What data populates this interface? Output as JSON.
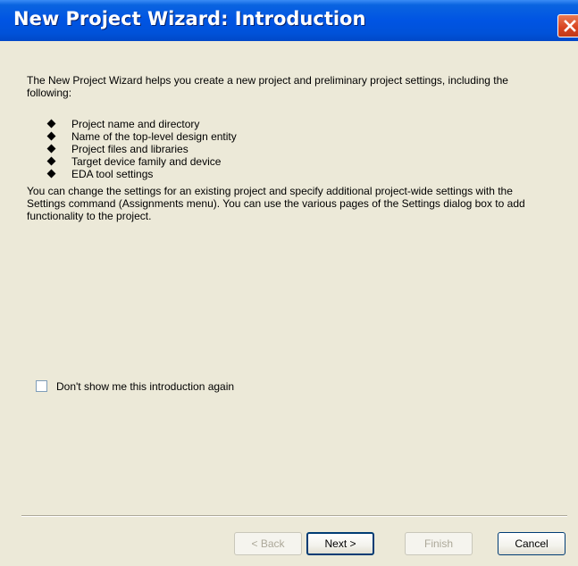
{
  "window": {
    "title": "New Project Wizard: Introduction",
    "close_icon": "close-icon"
  },
  "intro": {
    "paragraph1": "The New Project Wizard helps you create a new project and preliminary project settings, including the following:",
    "bullets": [
      "Project name and directory",
      "Name of the top-level design entity",
      "Project files and libraries",
      "Target device family and device",
      "EDA tool settings"
    ],
    "paragraph2": "You can change the settings for an existing project and specify additional project-wide settings with the Settings command (Assignments menu). You can use the various pages of the Settings dialog box to add functionality to the project."
  },
  "checkbox": {
    "label": "Don't show me this introduction again",
    "checked": false
  },
  "buttons": {
    "back": "< Back",
    "next": "Next >",
    "finish": "Finish",
    "cancel": "Cancel"
  },
  "colors": {
    "titlebar": "#0054e3",
    "close": "#d8431f",
    "dialog_bg": "#ece9d8"
  }
}
